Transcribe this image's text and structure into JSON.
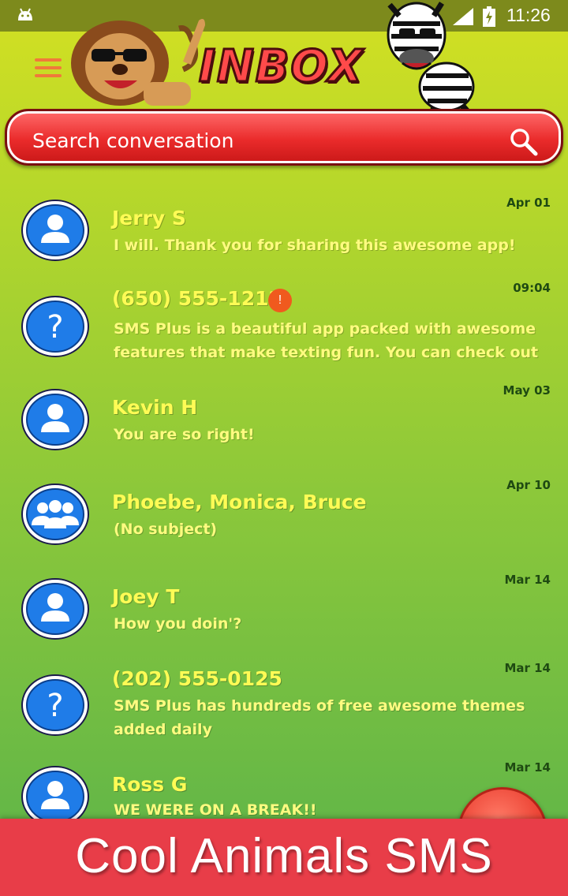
{
  "status_bar": {
    "time": "11:26"
  },
  "header": {
    "title": "INBOX"
  },
  "search": {
    "placeholder": "Search conversation"
  },
  "conversations": [
    {
      "name": "Jerry S",
      "message": "I will. Thank you for sharing this awesome app!",
      "date": "Apr 01",
      "avatar": "person-icon"
    },
    {
      "name": "(650) 555-1212",
      "message": "SMS Plus is a beautiful app packed with awesome features that make texting fun. You can check out www....",
      "date": "09:04",
      "avatar": "question-icon",
      "badge": "!"
    },
    {
      "name": "Kevin H",
      "message": "You are so right!",
      "date": "May 03",
      "avatar": "person-icon"
    },
    {
      "name": "Phoebe, Monica, Bruce",
      "message": "(No subject)",
      "date": "Apr 10",
      "avatar": "group-icon"
    },
    {
      "name": "Joey T",
      "message": "How you doin'?",
      "date": "Mar 14",
      "avatar": "person-icon"
    },
    {
      "name": "(202) 555-0125",
      "message": "SMS Plus has hundreds of free awesome themes added daily",
      "date": "Mar 14",
      "avatar": "question-icon"
    },
    {
      "name": "Ross G",
      "message": "WE WERE ON A BREAK!!",
      "date": "Mar 14",
      "avatar": "person-icon"
    }
  ],
  "banner": {
    "text": "Cool Animals SMS"
  },
  "colors": {
    "accent": "#e83d48",
    "name_text": "#fffb55",
    "date_text": "#1f4a12"
  }
}
